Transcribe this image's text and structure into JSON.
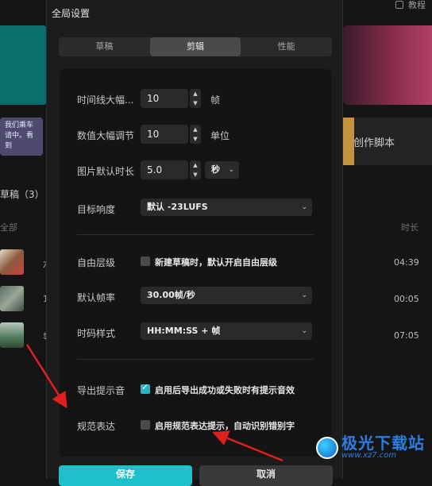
{
  "background_app": {
    "topbar_label": "教程",
    "promo_text": "我们乘车请中。看到",
    "script_card_label": "创作脚本",
    "drafts_title": "草稿（3）",
    "col_all": "全部",
    "col_duration": "时长",
    "rows": [
      {
        "letter": "六",
        "duration": "04:39"
      },
      {
        "letter": "1",
        "duration": "00:05"
      },
      {
        "letter": "导",
        "duration": "07:05"
      }
    ]
  },
  "dialog": {
    "title": "全局设置",
    "tabs": [
      {
        "label": "草稿",
        "active": false
      },
      {
        "label": "剪辑",
        "active": true
      },
      {
        "label": "性能",
        "active": false
      }
    ],
    "timeline_step": {
      "label": "时间线大幅...",
      "value": "10",
      "unit": "帧"
    },
    "value_step": {
      "label": "数值大幅调节",
      "value": "10",
      "unit": "单位"
    },
    "image_duration": {
      "label": "图片默认时长",
      "value": "5.0",
      "unit_select": "秒"
    },
    "target_loudness": {
      "label": "目标响度",
      "value": "默认 -23LUFS"
    },
    "free_layer": {
      "label": "自由层级",
      "checkbox_text": "新建草稿时，默认开启自由层级",
      "checked": false
    },
    "frame_rate": {
      "label": "默认帧率",
      "value": "30.00帧/秒"
    },
    "timecode": {
      "label": "时码样式",
      "value": "HH:MM:SS + 帧"
    },
    "export_sound": {
      "label": "导出提示音",
      "checkbox_text": "启用后导出成功或失败时有提示音效",
      "checked": true
    },
    "norm_expression": {
      "label": "规范表达",
      "checkbox_text": "启用规范表达提示，自动识别错别字",
      "checked": false
    },
    "save_label": "保存",
    "cancel_label": "取消"
  },
  "watermark": {
    "big": "极光下载站",
    "small": "www.xz7.com"
  },
  "colors": {
    "accent": "#1cc1cc",
    "arrow": "#e02020",
    "dialog_bg": "#1c1c1c",
    "panel_bg": "#141414"
  }
}
